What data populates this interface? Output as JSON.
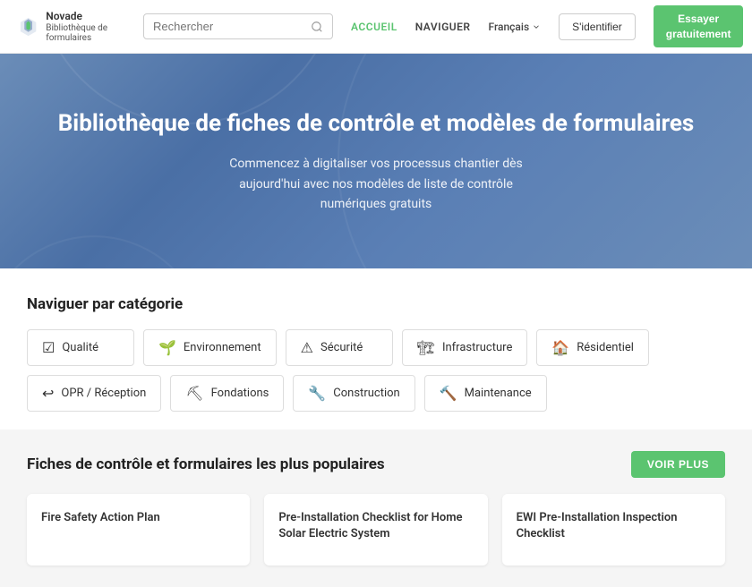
{
  "header": {
    "logo_name": "Novade",
    "logo_sub": "Bibliothèque de formulaires",
    "search_placeholder": "Rechercher",
    "nav": [
      {
        "label": "ACCUEIL",
        "active": true
      },
      {
        "label": "NAVIGUER",
        "active": false
      }
    ],
    "lang": "Français",
    "signin_label": "S'identifier",
    "trial_label": "Essayer gratuitement"
  },
  "hero": {
    "title": "Bibliothèque de fiches de contrôle et modèles de formulaires",
    "subtitle": "Commencez à digitaliser vos processus chantier dès aujourd'hui avec nos modèles de liste de contrôle numériques gratuits"
  },
  "categories": {
    "section_title": "Naviguer par catégorie",
    "items": [
      {
        "icon": "☑",
        "label": "Qualité"
      },
      {
        "icon": "🌱",
        "label": "Environnement"
      },
      {
        "icon": "⚠",
        "label": "Sécurité"
      },
      {
        "icon": "🏗",
        "label": "Infrastructure"
      },
      {
        "icon": "🏠",
        "label": "Résidentiel"
      },
      {
        "icon": "↩",
        "label": "OPR / Réception"
      },
      {
        "icon": "⛏",
        "label": "Fondations"
      },
      {
        "icon": "🔧",
        "label": "Construction"
      },
      {
        "icon": "🔨",
        "label": "Maintenance"
      }
    ]
  },
  "popular": {
    "section_title": "Fiches de contrôle et formulaires les plus populaires",
    "voir_plus_label": "VOIR PLUS",
    "cards": [
      {
        "title": "Fire Safety Action Plan"
      },
      {
        "title": "Pre-Installation Checklist for Home Solar Electric System"
      },
      {
        "title": "EWI Pre-Installation Inspection Checklist"
      }
    ]
  }
}
